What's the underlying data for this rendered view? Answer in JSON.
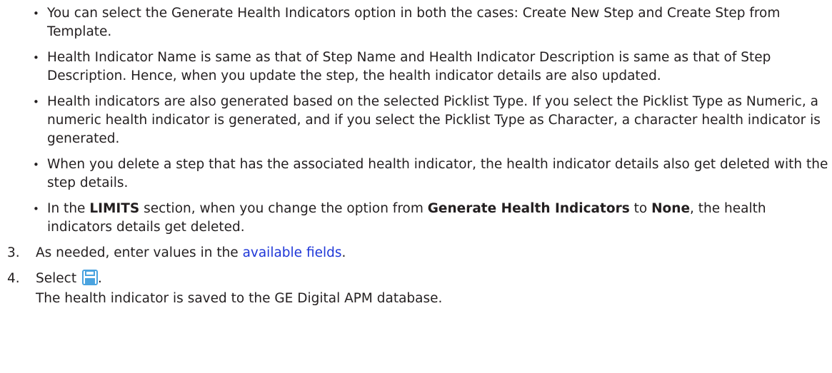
{
  "bullets": [
    {
      "text": "You can select the Generate Health Indicators option in both the cases: Create New Step and Create Step from Template."
    },
    {
      "text": "Health Indicator Name is same as that of Step Name and Health Indicator Description is same as that of Step Description. Hence, when you update the step, the health indicator details are also updated."
    },
    {
      "text": "Health indicators are also generated based on the selected Picklist Type. If you select the Picklist Type as Numeric, a numeric health indicator is generated, and if you select the Picklist Type as Character, a character health indicator is generated."
    },
    {
      "text": "When you delete a step that has the associated health indicator, the health indicator details also get deleted with the step details."
    }
  ],
  "bullet5": {
    "part1": "In the ",
    "bold1": "LIMITS",
    "part2": " section, when you change the option from ",
    "bold2": "Generate Health Indicators",
    "part3": " to ",
    "bold3": "None",
    "part4": ", the health indicators details get deleted."
  },
  "step3": {
    "num": "3.",
    "prefix": "As needed, enter values in the ",
    "link": "available fields",
    "suffix": "."
  },
  "step4": {
    "num": "4.",
    "prefix": "Select ",
    "suffix": ".",
    "icon": "save-icon",
    "result": "The health indicator is saved to the GE Digital APM database."
  },
  "colors": {
    "text": "#231f20",
    "link": "#1f37d8",
    "icon": "#4aa3df"
  }
}
